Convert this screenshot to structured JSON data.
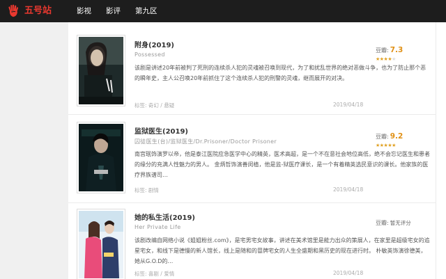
{
  "site": {
    "logo_icon": "hand-icon",
    "logo_text": "五号站",
    "brand_color": "#e8382f"
  },
  "nav": [
    {
      "label": "影视"
    },
    {
      "label": "影评"
    },
    {
      "label": "第九区"
    }
  ],
  "movies": [
    {
      "title": "附身",
      "year": "(2019)",
      "original_title": "Possessed",
      "description": "该剧是讲述20年前被判了死刑的连续杀人犯的灵魂被召唤到现代，为了和扰乱世界的绝对恶做斗争，也为了防止那个恶的瞬年史，主人公召唤20年前抓住了这个连续杀人犯的刑警的灵魂，继而展开的对决。",
      "tags": "标签: 奇幻 / 悬疑",
      "date": "2019/04/18",
      "rating_label": "豆瓣:",
      "rating_score": "7.3",
      "stars": {
        "on": "★★★★",
        "off": "★"
      }
    },
    {
      "title": "监狱医生",
      "year": "(2019)",
      "original_title": "囚徒医生(台)/监狱医生/Dr.Prisoner/Doctor Prisoner",
      "description": "南宫珉饰演罗以帝，他是泰江医院应急医学中心的精英，医术高超，是一个不在意社会地位高低，绝不会忘记医生和患者的缘分的充满人性魅力的男人。 金炳哲饰演善闵植，他是监-狱医疗课长，是一个有着精英选民意识的课长。他家族的医疗界族谱司…",
      "tags": "标签: 剧情",
      "date": "2019/04/18",
      "rating_label": "豆瓣:",
      "rating_score": "9.2",
      "stars": {
        "on": "★★★★★",
        "off": ""
      }
    },
    {
      "title": "她的私生活",
      "year": "(2019)",
      "original_title": "Her Private Life",
      "description": "该剧改编自网络小说《姐姐粉丝.com》，是宅男宅女故事，讲述在美术馆里是能力出众的策展人，在家里是超级宅女的追星宅女，和线下是德慢的新人馆长，线上是随和的冒牌宅女的人生全盛期和黑历史的现在进行时。 朴敏英饰演徐德美，她从G.O.D的…",
      "tags": "标签: 喜剧 / 爱情",
      "date": "2019/04/18",
      "rating_label": "豆瓣:",
      "rating_none": "暂无评分",
      "stars": {
        "on": "",
        "off": ""
      }
    }
  ]
}
